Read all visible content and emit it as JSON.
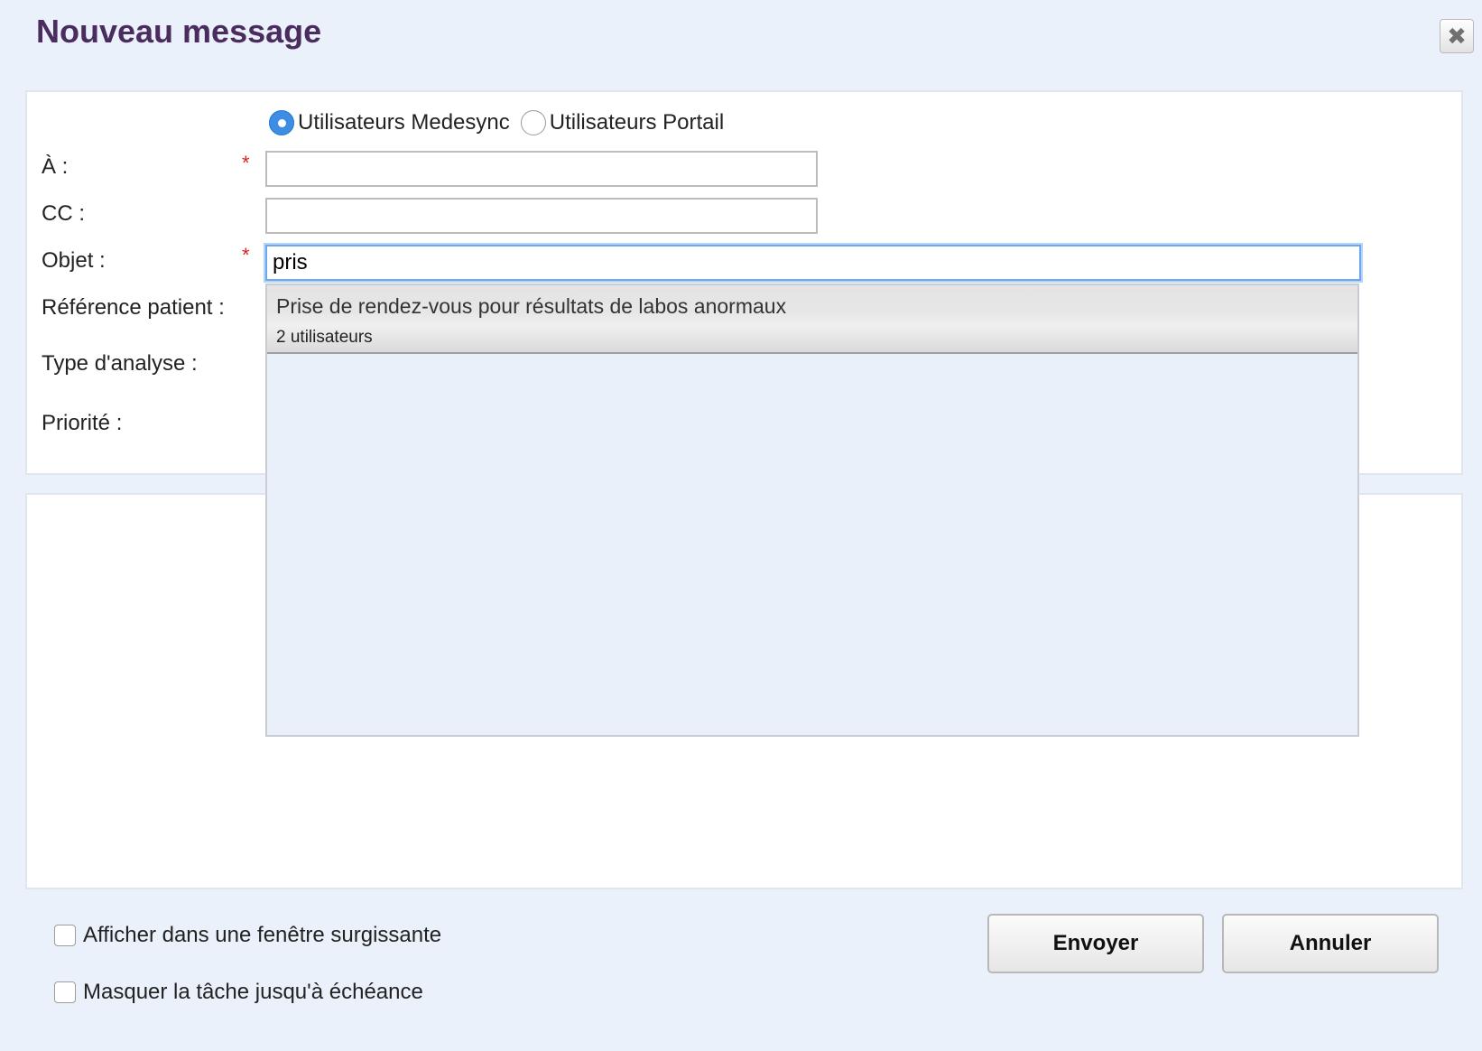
{
  "dialog": {
    "title": "Nouveau message",
    "close_icon": "close-icon"
  },
  "recipients_type": {
    "options": [
      {
        "label": "Utilisateurs Medesync",
        "checked": true
      },
      {
        "label": "Utilisateurs Portail",
        "checked": false
      }
    ]
  },
  "form": {
    "to_label": "À :",
    "cc_label": "CC :",
    "subject_label": "Objet :",
    "patient_ref_label": "Référence patient :",
    "analysis_type_label": "Type d'analyse :",
    "priority_label": "Priorité :",
    "required_marker": "*",
    "to_value": "",
    "cc_value": "",
    "subject_value": "pris"
  },
  "autocomplete": {
    "items": [
      {
        "title": "Prise de rendez-vous pour résultats de labos anormaux",
        "subtitle": "2 utilisateurs"
      }
    ]
  },
  "options": {
    "popup_label": "Afficher dans une fenêtre surgissante",
    "hide_task_label": "Masquer la tâche jusqu'à échéance"
  },
  "actions": {
    "send_label": "Envoyer",
    "cancel_label": "Annuler"
  },
  "colors": {
    "title": "#4a2c5f",
    "background": "#eaf1fa",
    "radio_selected": "#3b8de6",
    "required": "#e0201e",
    "focus_ring": "#6aa7f0"
  }
}
